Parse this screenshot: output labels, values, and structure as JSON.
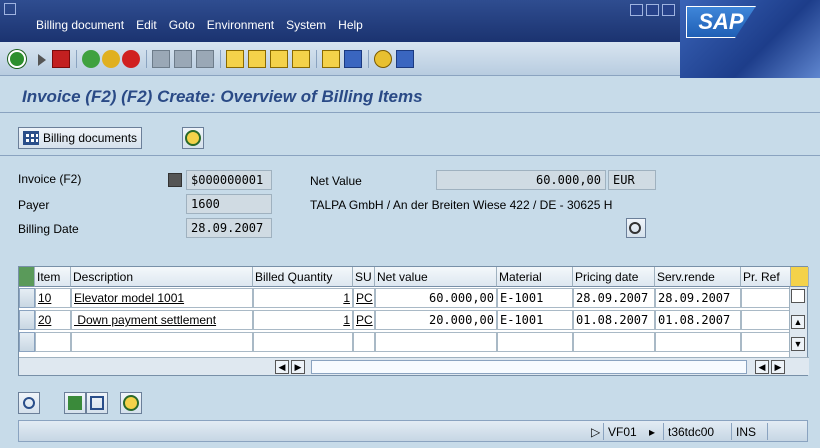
{
  "menu": [
    "Billing document",
    "Edit",
    "Goto",
    "Environment",
    "System",
    "Help"
  ],
  "logo": "SAP",
  "page_title": "Invoice (F2)  (F2) Create: Overview of Billing Items",
  "appbar": {
    "billing_documents_label": "Billing documents"
  },
  "header": {
    "doc_type_label": "Invoice (F2)",
    "doc_number": "$000000001",
    "net_value_label": "Net Value",
    "net_value": "60.000,00",
    "currency": "EUR",
    "payer_label": "Payer",
    "payer": "1600",
    "payer_address": "TALPA GmbH / An der Breiten Wiese 422 / DE - 30625 H",
    "billing_date_label": "Billing Date",
    "billing_date": "28.09.2007"
  },
  "table": {
    "columns": [
      "Item",
      "Description",
      "Billed Quantity",
      "SU",
      "Net value",
      "Material",
      "Pricing date",
      "Serv.rende",
      "Pr. Ref"
    ],
    "rows": [
      {
        "item": "10",
        "description": "Elevator model 1001",
        "qty": "1",
        "su": "PC",
        "net_value": "60.000,00",
        "material": "E-1001",
        "pricing_date": "28.09.2007",
        "serv_rendered": "28.09.2007"
      },
      {
        "item": "20",
        "description": " Down payment settlement",
        "qty": "1",
        "su": "PC",
        "net_value": "20.000,00",
        "material": "E-1001",
        "pricing_date": "01.08.2007",
        "serv_rendered": "01.08.2007"
      }
    ]
  },
  "status": {
    "transaction": "VF01",
    "server": "t36tdc00",
    "mode": "INS"
  },
  "colors": {
    "background": "#c7dbe9",
    "title": "#2a4a86",
    "menubar": "#1b3370"
  }
}
